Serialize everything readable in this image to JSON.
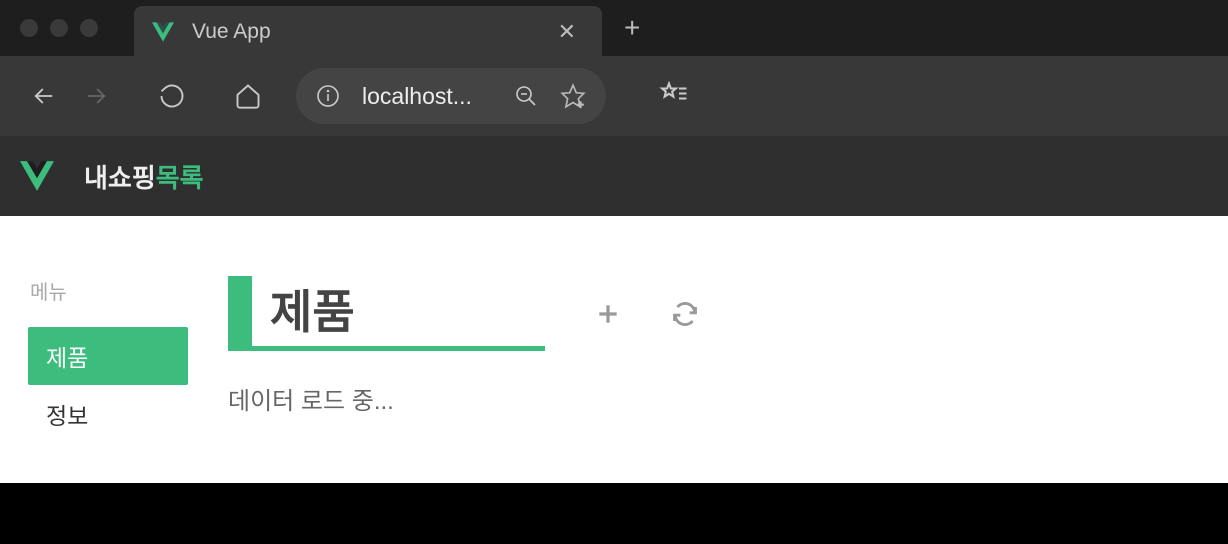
{
  "browser": {
    "tab_title": "Vue App",
    "address": "localhost..."
  },
  "app": {
    "header": {
      "title_part1": "내쇼핑",
      "title_part2": "목록"
    },
    "sidebar": {
      "label": "메뉴",
      "items": [
        {
          "label": "제품",
          "active": true
        },
        {
          "label": "정보",
          "active": false
        }
      ]
    },
    "main": {
      "title": "제품",
      "loading_text": "데이터 로드 중..."
    }
  }
}
